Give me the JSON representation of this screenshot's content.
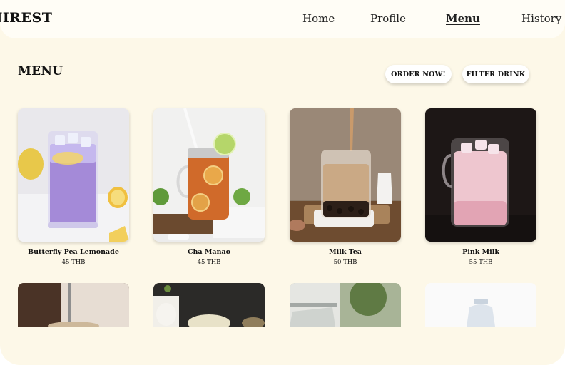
{
  "brand": "NIREST",
  "nav": {
    "home": "Home",
    "profile": "Profile",
    "menu": "Menu",
    "history": "History"
  },
  "page": {
    "title": "MENU",
    "order_button": "ORDER NOW!",
    "filter_button": "FILTER DRINK"
  },
  "menu_items": [
    {
      "name": "Butterfly Pea Lemonade",
      "price": "45 THB"
    },
    {
      "name": "Cha Manao",
      "price": "45 THB"
    },
    {
      "name": "Milk Tea",
      "price": "50 THB"
    },
    {
      "name": "Pink Milk",
      "price": "55 THB"
    }
  ],
  "colors": {
    "background": "#fdf8e8",
    "topbar": "#fffdf6",
    "text": "#111111"
  }
}
